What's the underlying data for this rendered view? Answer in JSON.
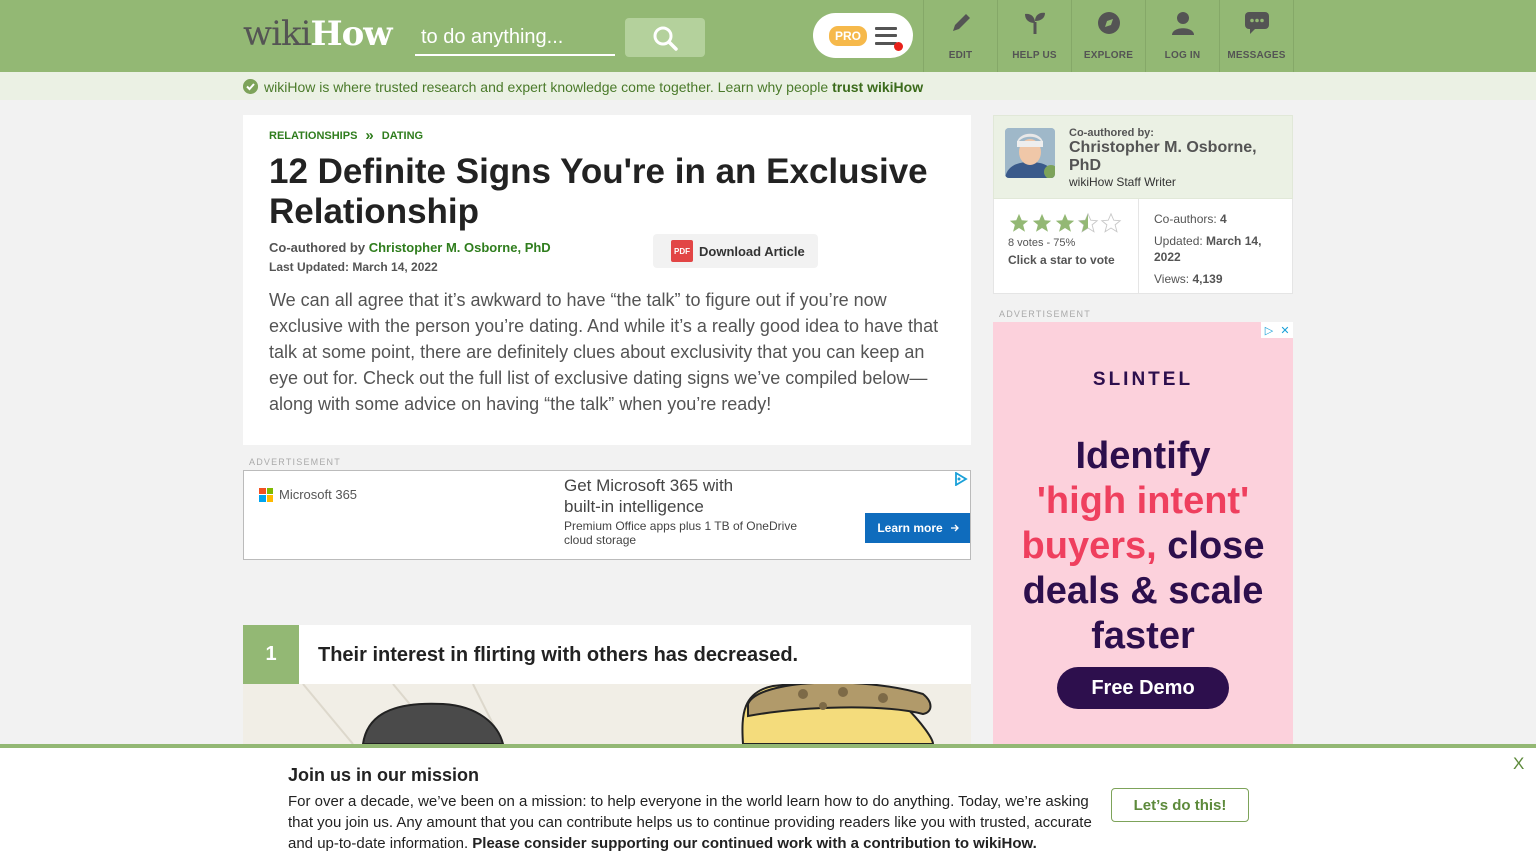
{
  "header": {
    "logo_wiki": "wiki",
    "logo_how": "How",
    "search_placeholder": "to do anything...",
    "pro_label": "PRO",
    "nav": [
      {
        "label": "EDIT",
        "icon": "pencil-icon"
      },
      {
        "label": "HELP US",
        "icon": "sprout-icon"
      },
      {
        "label": "EXPLORE",
        "icon": "compass-icon"
      },
      {
        "label": "LOG IN",
        "icon": "user-icon"
      },
      {
        "label": "MESSAGES",
        "icon": "chat-bubble-icon"
      }
    ],
    "colors": {
      "bar": "#93b874",
      "pro_badge": "#f6b94b",
      "notify_dot": "#e8211b"
    }
  },
  "trust": {
    "text": "wikiHow is where trusted research and expert knowledge come together. Learn why people",
    "link": "trust wikiHow"
  },
  "article": {
    "breadcrumb": [
      "RELATIONSHIPS",
      "DATING"
    ],
    "breadcrumb_sep": "»",
    "title": "12 Definite Signs You're in an Exclusive Relationship",
    "coauthored_prefix": "Co-authored by",
    "coauthor": "Christopher M. Osborne, PhD",
    "last_updated": "Last Updated: March 14, 2022",
    "download_label": "Download Article",
    "pdf_label": "PDF",
    "intro": "We can all agree that it’s awkward to have “the talk” to figure out if you’re now exclusive with the person you’re dating. And while it’s a really good idea to have that talk at some point, there are definitely clues about exclusivity that you can keep an eye out for. Check out the full list of exclusive dating signs we’ve compiled below—along with some advice on having “the talk” when you’re ready!"
  },
  "ads": {
    "label": "ADVERTISEMENT",
    "ms": {
      "brand": "Microsoft 365",
      "headline_1": "Get Microsoft 365 with",
      "headline_2": "built-in intelligence",
      "sub": "Premium Office apps plus 1 TB of OneDrive cloud storage",
      "cta": "Learn more"
    },
    "slintel": {
      "brand": "SLINTEL",
      "line1": "Identify",
      "line2": "'high intent'",
      "line3_hl": "buyers,",
      "line3": " close",
      "line4": "deals & scale",
      "line5": "faster",
      "cta": "Free Demo",
      "close": "✕",
      "choice": "▷"
    }
  },
  "step": {
    "number": "1",
    "text": "Their interest in flirting with others has decreased."
  },
  "sidebar": {
    "coauthored_label": "Co-authored by:",
    "author_name": "Christopher M. Osborne, PhD",
    "author_role": "wikiHow Staff Writer",
    "rating_percent": 75,
    "votes": "8 votes - 75%",
    "click_vote": "Click a star to vote",
    "coauthors_label": "Co-authors:",
    "coauthors_value": "4",
    "updated_label": "Updated:",
    "updated_value": "March 14, 2022",
    "views_label": "Views:",
    "views_value": "4,139"
  },
  "mission": {
    "title": "Join us in our mission",
    "body": "For over a decade, we’ve been on a mission: to help everyone in the world learn how to do anything. Today, we’re asking that you join us. Any amount that you can contribute helps us to continue providing readers like you with trusted, accurate and up-to-date information.",
    "body_bold": "Please consider supporting our continued work with a contribution to wikiHow.",
    "button": "Let’s do this!",
    "close": "X"
  }
}
